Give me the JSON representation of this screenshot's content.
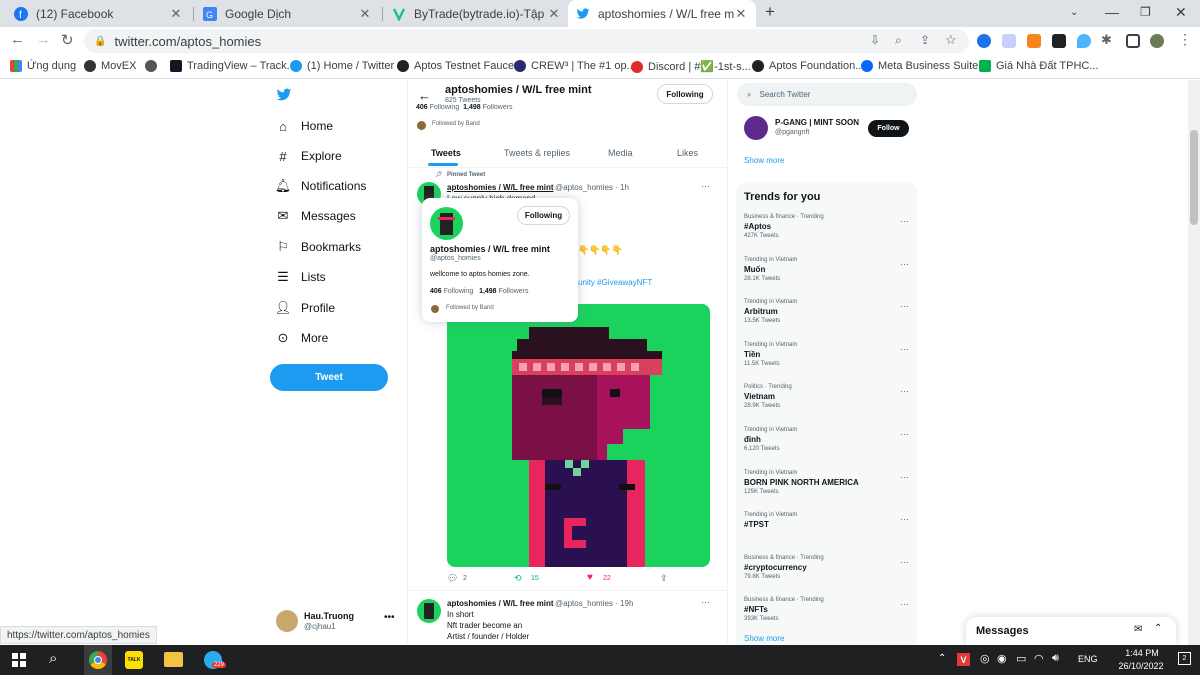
{
  "browser": {
    "tabs": [
      {
        "title": "(12) Facebook",
        "icon": "facebook-icon"
      },
      {
        "title": "Google Dịch",
        "icon": "google-translate-icon"
      },
      {
        "title": "ByTrade(bytrade.io)-Tập trung và",
        "icon": "bytrade-icon"
      },
      {
        "title": "aptoshomies / W/L free mint (@a",
        "icon": "twitter-icon"
      }
    ],
    "url": "twitter.com/aptos_homies",
    "status_url": "https://twitter.com/aptos_homies"
  },
  "bookmarks": [
    "Ứng dụng",
    "MovEX",
    "TradingView – Track...",
    "(1) Home / Twitter",
    "Aptos Testnet Faucet",
    "CREW³ | The #1 op...",
    "Discord | #✅-1st-s...",
    "Aptos Foundation...",
    "Meta Business Suite",
    "Giá Nhà Đất TPHC..."
  ],
  "nav": {
    "items": [
      "Home",
      "Explore",
      "Notifications",
      "Messages",
      "Bookmarks",
      "Lists",
      "Profile",
      "More"
    ],
    "tweet_button": "Tweet",
    "account_name": "Hau.Truong",
    "account_handle": "@cjhau1"
  },
  "profile": {
    "name": "aptoshomies / W/L free mint",
    "tweet_count": "825 Tweets",
    "following_btn": "Following",
    "stats_peek_following": "406",
    "stats_peek_following_label": "Following",
    "stats_peek_followers": "1,498",
    "stats_peek_followers_label": "Followers",
    "followed_by": "Followed by Band",
    "tabs": [
      "Tweets",
      "Tweets & replies",
      "Media",
      "Likes"
    ]
  },
  "pinned": {
    "label": "Pinned Tweet",
    "author": "aptoshomies / W/L free mint",
    "handle_time": "@aptos_homies · 1h",
    "line1": "Low supply high demand",
    "hashtags_fragment": "unity #GiveawayNFT",
    "emoji_fragment": "👇👇👇👇",
    "replies": "2",
    "retweets": "15",
    "likes": "22"
  },
  "hovercard": {
    "name": "aptoshomies / W/L free mint",
    "handle": "@aptos_homies",
    "button": "Following",
    "bio": "wellcome to aptos homies zone.",
    "following": "406",
    "following_label": "Following",
    "followers": "1,498",
    "followers_label": "Followers",
    "followed_by": "Followed by Band"
  },
  "second_tweet": {
    "author": "aptoshomies / W/L free mint",
    "handle_time": "@aptos_homies · 19h",
    "line1": "In short",
    "line2": "Nft trader become an",
    "line3": "Artist / founder / Holder"
  },
  "right": {
    "search_placeholder": "Search Twitter",
    "suggest_name": "P-GANG | MINT SOON",
    "suggest_handle": "@pgangnft",
    "follow_btn": "Follow",
    "show_more": "Show more",
    "trends_title": "Trends for you",
    "trends": [
      {
        "meta": "Business & finance · Trending",
        "name": "#Aptos",
        "count": "427K Tweets"
      },
      {
        "meta": "Trending in Vietnam",
        "name": "Muốn",
        "count": "28.1K Tweets"
      },
      {
        "meta": "Trending in Vietnam",
        "name": "Arbitrum",
        "count": "13.5K Tweets"
      },
      {
        "meta": "Trending in Vietnam",
        "name": "Tiền",
        "count": "11.5K Tweets"
      },
      {
        "meta": "Politics · Trending",
        "name": "Vietnam",
        "count": "28.9K Tweets"
      },
      {
        "meta": "Trending in Vietnam",
        "name": "đỉnh",
        "count": "6,120 Tweets"
      },
      {
        "meta": "Trending in Vietnam",
        "name": "BORN PINK NORTH AMERICA",
        "count": "125K Tweets"
      },
      {
        "meta": "Trending in Vietnam",
        "name": "#TPST",
        "count": ""
      },
      {
        "meta": "Business & finance · Trending",
        "name": "#cryptocurrency",
        "count": "79.8K Tweets"
      },
      {
        "meta": "Business & finance · Trending",
        "name": "#NFTs",
        "count": "393K Tweets"
      }
    ],
    "trends_show_more": "Show more",
    "messages": "Messages"
  },
  "taskbar": {
    "lang": "ENG",
    "time": "1:44 PM",
    "date": "26/10/2022",
    "notif_count": "2",
    "telegram_badge": "229"
  },
  "colors": {
    "accent": "#1d9bf0",
    "nft_bg": "#19d35d"
  }
}
